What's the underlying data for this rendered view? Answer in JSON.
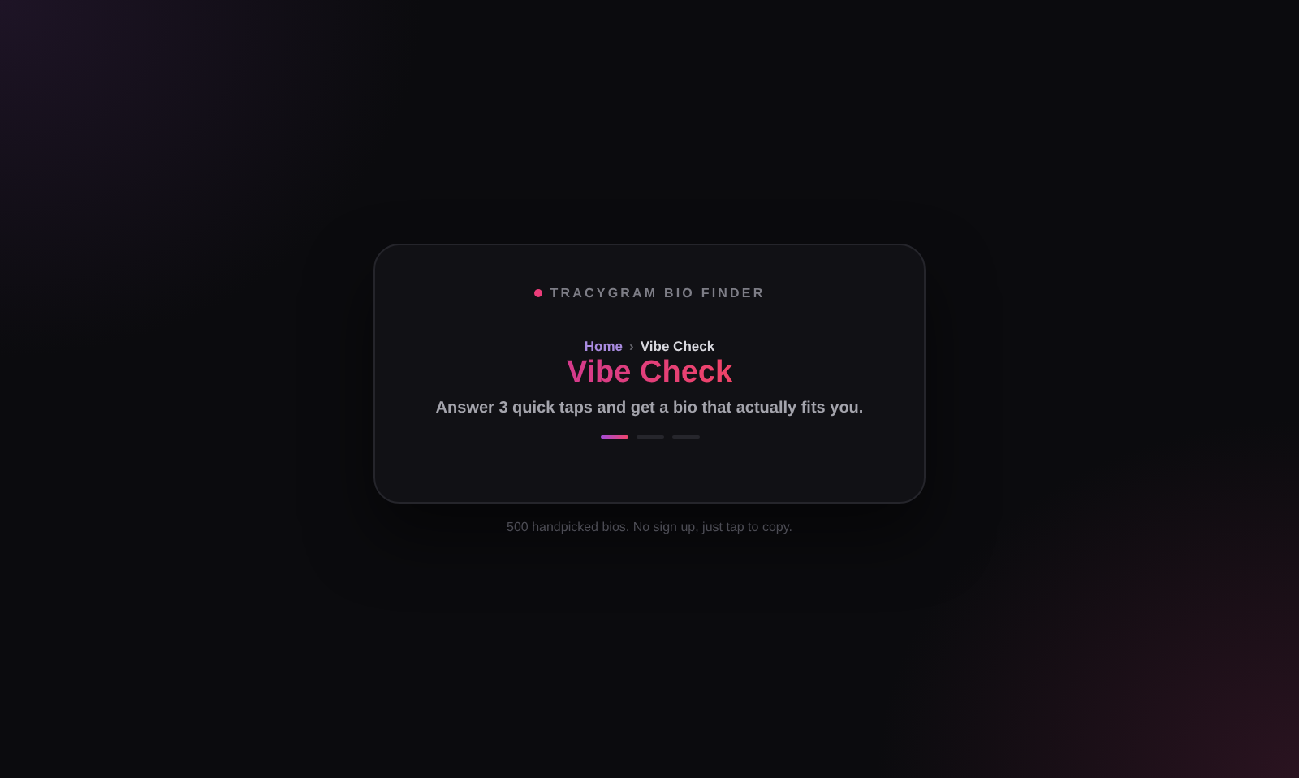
{
  "brand": {
    "label": "TRACYGRAM BIO FINDER"
  },
  "breadcrumb": {
    "home": "Home",
    "separator": "›",
    "current": "Vibe Check"
  },
  "title": "Vibe Check",
  "subtitle": "Answer 3 quick taps and get a bio that actually fits you.",
  "steps": [
    {
      "selected": true
    },
    {
      "selected": false
    },
    {
      "selected": false
    }
  ],
  "footer": "500 handpicked bios. No sign up, just tap to copy."
}
